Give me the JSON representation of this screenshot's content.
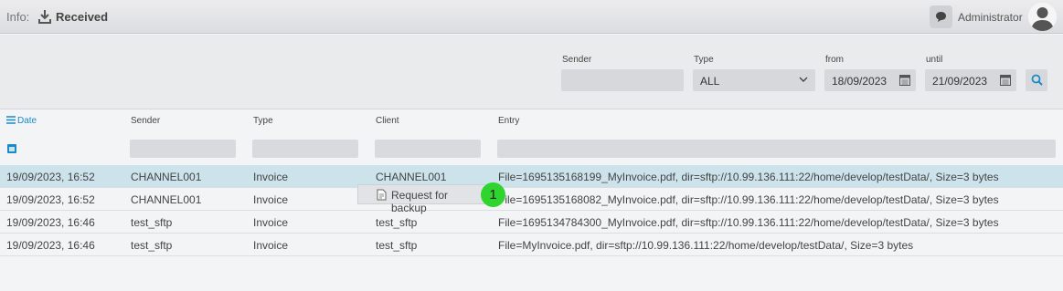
{
  "header": {
    "info_label": "Info:",
    "title": "Received",
    "user": "Administrator",
    "icons": {
      "download": "download-icon",
      "chat": "chat-icon",
      "avatar": "user-avatar"
    }
  },
  "filters": {
    "sender_label": "Sender",
    "sender_value": "",
    "type_label": "Type",
    "type_value": "ALL",
    "from_label": "from",
    "from_value": "18/09/2023",
    "until_label": "until",
    "until_value": "21/09/2023"
  },
  "table": {
    "columns": [
      "Date",
      "Sender",
      "Type",
      "Client",
      "Entry"
    ],
    "rows": [
      [
        "19/09/2023, 16:52",
        "CHANNEL001",
        "Invoice",
        "CHANNEL001",
        "File=1695135168199_MyInvoice.pdf, dir=sftp://10.99.136.111:22/home/develop/testData/, Size=3 bytes"
      ],
      [
        "19/09/2023, 16:52",
        "CHANNEL001",
        "Invoice",
        "",
        "File=1695135168082_MyInvoice.pdf, dir=sftp://10.99.136.111:22/home/develop/testData/, Size=3 bytes"
      ],
      [
        "19/09/2023, 16:46",
        "test_sftp",
        "Invoice",
        "test_sftp",
        "File=1695134784300_MyInvoice.pdf, dir=sftp://10.99.136.111:22/home/develop/testData/, Size=3 bytes"
      ],
      [
        "19/09/2023, 16:46",
        "test_sftp",
        "Invoice",
        "test_sftp",
        "File=MyInvoice.pdf, dir=sftp://10.99.136.111:22/home/develop/testData/, Size=3 bytes"
      ]
    ],
    "selected_row": 0
  },
  "context_menu": {
    "item": "Request for backup"
  },
  "badge": "1",
  "colors": {
    "accent": "#1b8ac8",
    "selected_row": "#cde3ec",
    "badge": "#2fd42f"
  }
}
